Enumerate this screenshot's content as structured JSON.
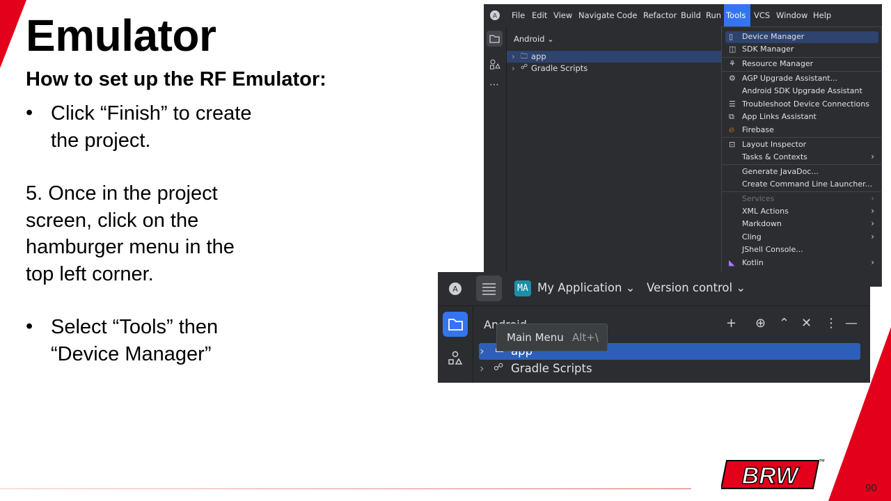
{
  "slide": {
    "title": "Emulator",
    "subtitle": "How to set up the RF Emulator:",
    "bullet1_line1": "Click “Finish” to create",
    "bullet1_line2": "the project.",
    "step5_line1": "5. Once in the project",
    "step5_line2": "screen, click on the",
    "step5_line3": "hamburger menu in the",
    "step5_line4": "top left corner.",
    "bullet2_line1": "Select “Tools” then",
    "bullet2_line2": "“Device Manager”",
    "bullet_glyph": "•",
    "page_number": "90",
    "logo_text": "BRW",
    "logo_tm": "™"
  },
  "colors": {
    "accent_red": "#e3001b",
    "ide_bg": "#2b2d30",
    "ide_select": "#2e436e",
    "ide_blue": "#3574f0"
  },
  "ide_menu": {
    "menubar": [
      "File",
      "Edit",
      "View",
      "Navigate",
      "Code",
      "Refactor",
      "Build",
      "Run",
      "Tools",
      "VCS",
      "Window",
      "Help"
    ],
    "project_header": "Android ⌄",
    "tree": [
      "app",
      "Gradle Scripts"
    ],
    "tools_items": [
      {
        "label": "Device Manager",
        "icon": "device-icon"
      },
      {
        "label": "SDK Manager",
        "icon": "sdk-icon"
      },
      {
        "label": "Resource Manager",
        "icon": "resource-icon"
      },
      {
        "label": "AGP Upgrade Assistant...",
        "icon": "upgrade-icon"
      },
      {
        "label": "Android SDK Upgrade Assistant",
        "icon": ""
      },
      {
        "label": "Troubleshoot Device Connections",
        "icon": "list-icon"
      },
      {
        "label": "App Links Assistant",
        "icon": "link-icon"
      },
      {
        "label": "Firebase",
        "icon": "firebase-icon"
      },
      {
        "label": "Layout Inspector",
        "icon": "inspector-icon"
      },
      {
        "label": "Tasks & Contexts",
        "icon": ""
      },
      {
        "label": "Generate JavaDoc...",
        "icon": ""
      },
      {
        "label": "Create Command Line Launcher...",
        "icon": ""
      },
      {
        "label": "Services",
        "icon": ""
      },
      {
        "label": "XML Actions",
        "icon": ""
      },
      {
        "label": "Markdown",
        "icon": ""
      },
      {
        "label": "Cling",
        "icon": ""
      },
      {
        "label": "JShell Console...",
        "icon": ""
      },
      {
        "label": "Kotlin",
        "icon": "kotlin-icon"
      }
    ]
  },
  "ide_main": {
    "project_badge": "MA",
    "project_name": "My Application ⌄",
    "version_control": "Version control ⌄",
    "view_label": "Android",
    "tree": [
      "app",
      "Gradle Scripts"
    ],
    "tooltip_label": "Main Menu",
    "tooltip_shortcut": "Alt+\\"
  }
}
